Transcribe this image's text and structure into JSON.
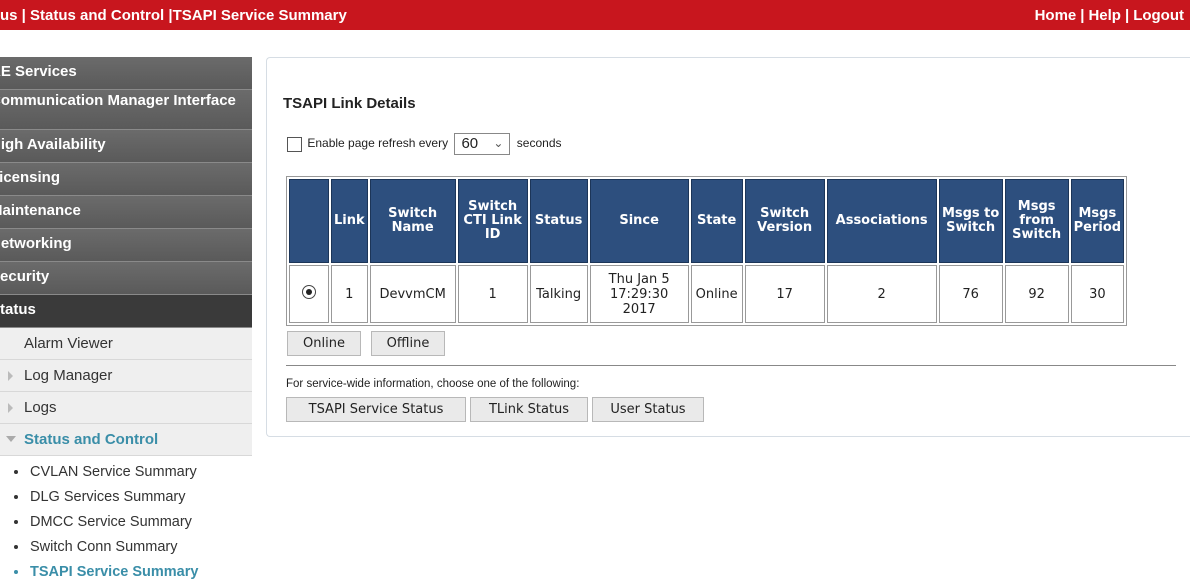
{
  "header": {
    "breadcrumb": "us | Status and Control |TSAPI Service Summary",
    "links": [
      "Home",
      "Help",
      "Logout"
    ]
  },
  "nav": {
    "main": [
      {
        "label": "AE Services"
      },
      {
        "label": "Communication Manager Interface"
      },
      {
        "label": "High Availability"
      },
      {
        "label": "Licensing"
      },
      {
        "label": "Maintenance"
      },
      {
        "label": "Networking"
      },
      {
        "label": "Security"
      },
      {
        "label": "Status"
      }
    ],
    "sub": [
      "Alarm Viewer",
      "Log Manager",
      "Logs",
      "Status and Control"
    ],
    "status_control_items": [
      "CVLAN Service Summary",
      "DLG Services Summary",
      "DMCC Service Summary",
      "Switch Conn Summary",
      "TSAPI Service Summary"
    ]
  },
  "panel": {
    "title": "TSAPI Link Details",
    "refresh_prefix": "Enable page refresh every",
    "refresh_value": "60",
    "refresh_suffix": "seconds",
    "table": {
      "headers": [
        "",
        "Link",
        "Switch Name",
        "Switch CTI Link ID",
        "Status",
        "Since",
        "State",
        "Switch Version",
        "Associations",
        "Msgs to Switch",
        "Msgs from Switch",
        "Msgs Period"
      ],
      "rows": [
        {
          "link": "1",
          "switch_name": "DevvmCM",
          "cti_link_id": "1",
          "status": "Talking",
          "since": "Thu Jan 5 17:29:30 2017",
          "state": "Online",
          "switch_version": "17",
          "associations": "2",
          "msgs_to": "76",
          "msgs_from": "92",
          "msgs_period": "30"
        }
      ]
    },
    "buttons": {
      "online": "Online",
      "offline": "Offline"
    },
    "info_text": "For service-wide information, choose one of the following:",
    "service_buttons": [
      "TSAPI Service Status",
      "TLink Status",
      "User Status"
    ]
  }
}
